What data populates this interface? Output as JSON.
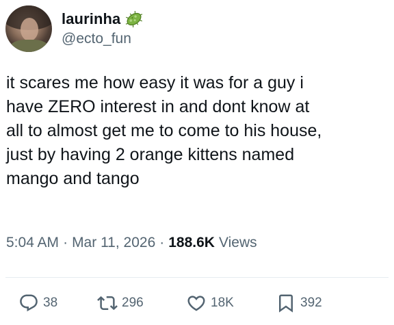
{
  "user": {
    "display_name": "laurinha",
    "handle": "@ecto_fun",
    "emoji_icon": "microbe-icon"
  },
  "tweet": {
    "text": "it scares me how easy it was for a guy i\nhave ZERO interest in and dont know at\nall to almost get me to come to his house,\njust by having 2 orange kittens named\nmango and tango"
  },
  "meta": {
    "time": "5:04 AM",
    "separator": "·",
    "date": "Mar 11, 2026",
    "views_count": "188.6K",
    "views_label": "Views"
  },
  "actions": {
    "replies": "38",
    "reposts": "296",
    "likes": "18K",
    "bookmarks": "392"
  },
  "colors": {
    "text_primary": "#0f1419",
    "text_secondary": "#536471",
    "divider": "#e6ecf0",
    "emoji_green": "#7cb342"
  }
}
